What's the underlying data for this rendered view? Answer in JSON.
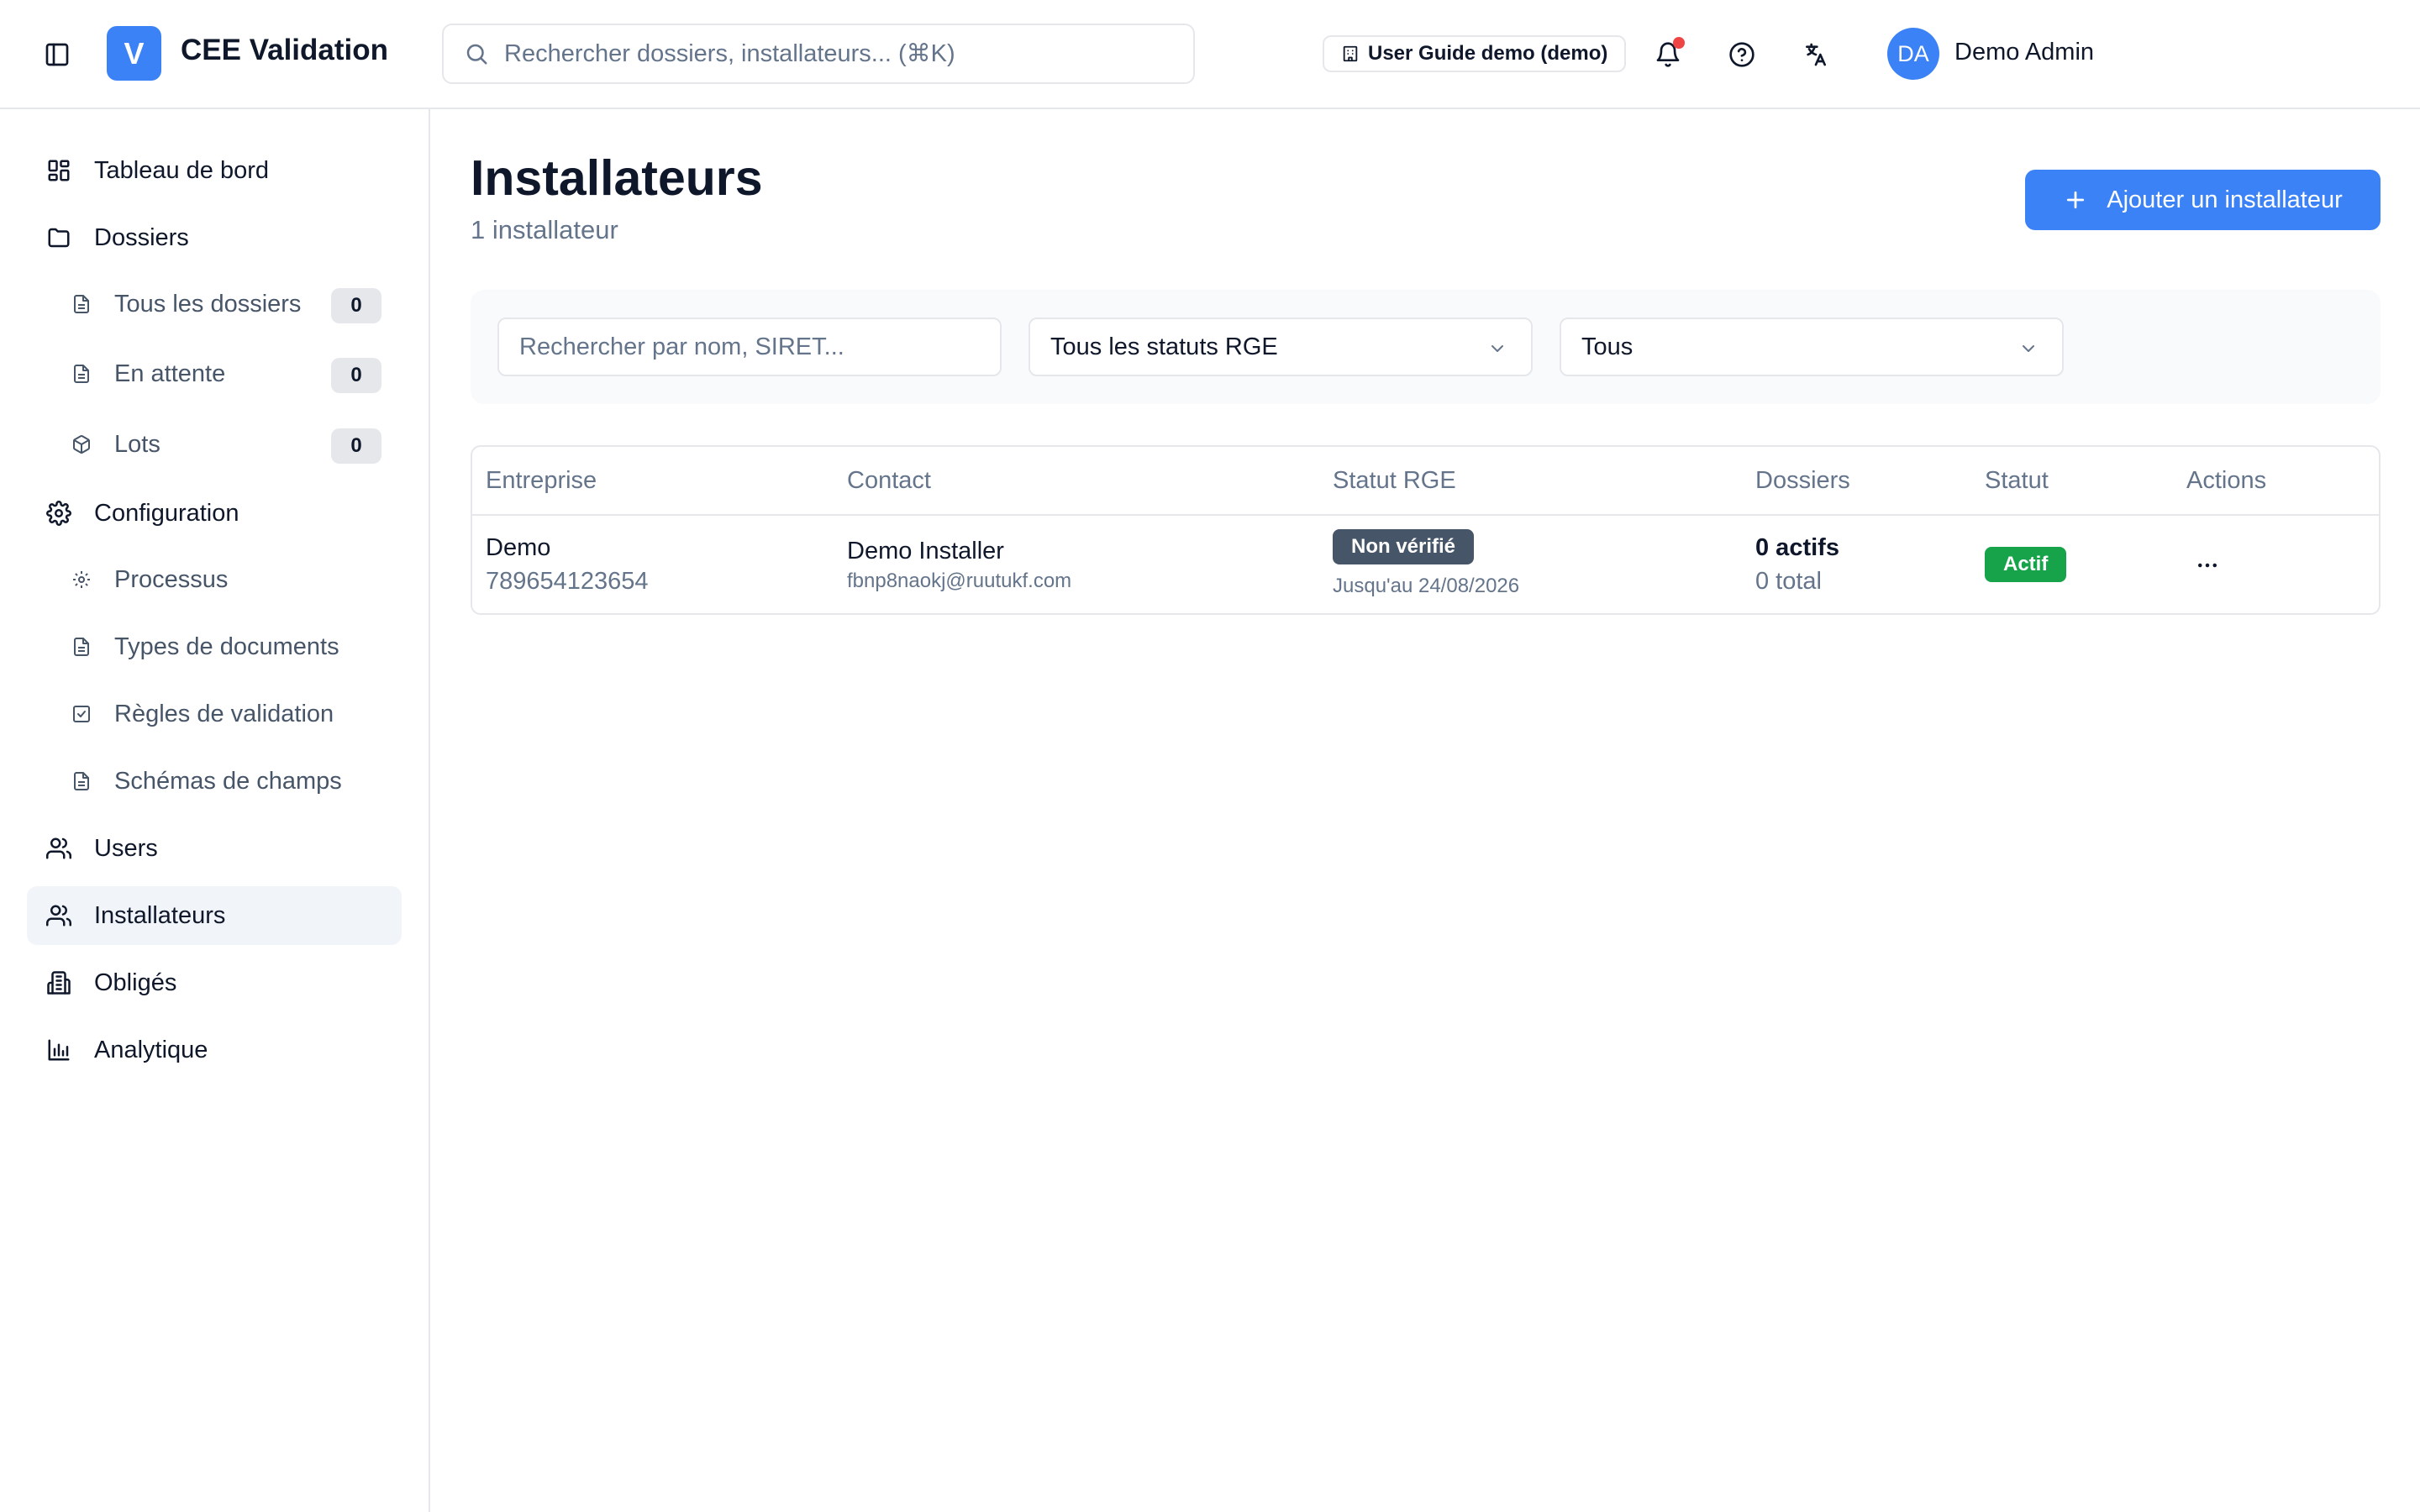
{
  "app": {
    "logo_letter": "V",
    "name": "CEE Validation"
  },
  "header": {
    "search_placeholder": "Rechercher dossiers, installateurs... (⌘K)",
    "org_badge": "User Guide demo (demo)",
    "user_initials": "DA",
    "user_name": "Demo Admin",
    "has_notification": true
  },
  "sidebar": {
    "items": [
      {
        "label": "Tableau de bord",
        "icon": "dashboard-icon"
      },
      {
        "label": "Dossiers",
        "icon": "folder-icon"
      },
      {
        "label": "Tous les dossiers",
        "icon": "file-icon",
        "count": "0"
      },
      {
        "label": "En attente",
        "icon": "file-icon",
        "count": "0"
      },
      {
        "label": "Lots",
        "icon": "package-icon",
        "count": "0"
      },
      {
        "label": "Configuration",
        "icon": "gear-icon"
      },
      {
        "label": "Processus",
        "icon": "gear-icon"
      },
      {
        "label": "Types de documents",
        "icon": "file-icon"
      },
      {
        "label": "Règles de validation",
        "icon": "check-square-icon"
      },
      {
        "label": "Schémas de champs",
        "icon": "file-icon"
      },
      {
        "label": "Users",
        "icon": "users-icon"
      },
      {
        "label": "Installateurs",
        "icon": "users-icon",
        "active": true
      },
      {
        "label": "Obligés",
        "icon": "building-icon"
      },
      {
        "label": "Analytique",
        "icon": "bar-chart-icon"
      }
    ]
  },
  "main": {
    "title": "Installateurs",
    "subtitle": "1 installateur",
    "add_button": "Ajouter un installateur",
    "filters": {
      "search_placeholder": "Rechercher par nom, SIRET...",
      "rge_status": "Tous les statuts RGE",
      "status": "Tous"
    },
    "table": {
      "columns": [
        "Entreprise",
        "Contact",
        "Statut RGE",
        "Dossiers",
        "Statut",
        "Actions"
      ],
      "rows": [
        {
          "company": "Demo",
          "siret": "789654123654",
          "contact_name": "Demo Installer",
          "contact_email": "fbnp8naokj@ruutukf.com",
          "rge_status": "Non vérifié",
          "rge_until": "Jusqu'au 24/08/2026",
          "dossiers_active": "0 actifs",
          "dossiers_total": "0 total",
          "status": "Actif"
        }
      ]
    }
  },
  "colors": {
    "accent": "#3b82f6",
    "active_badge": "#16a34a",
    "unverified_badge": "#475569",
    "notification": "#ef4444"
  }
}
